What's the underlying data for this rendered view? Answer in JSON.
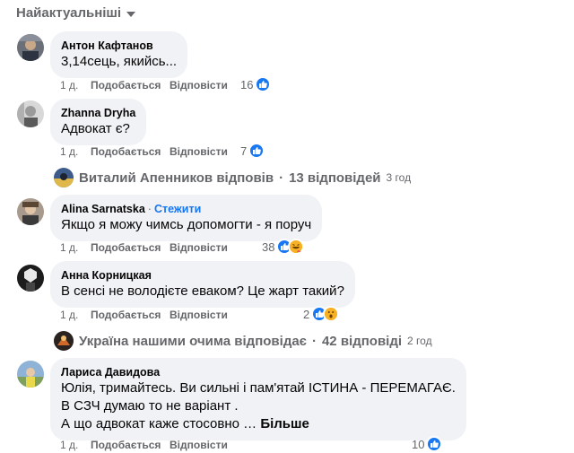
{
  "sort": {
    "label": "Найактуальніші"
  },
  "labels": {
    "like": "Подобається",
    "reply": "Відповісти",
    "dot": "·"
  },
  "comments": [
    {
      "author": "Антон Кафтанов",
      "text": [
        "3,14сець, якийсь..."
      ],
      "time": "1 д.",
      "reactions": "16",
      "reaction_icons": [
        "like-icon"
      ]
    },
    {
      "author": "Zhanna Dryha",
      "text": [
        "Адвокат є?"
      ],
      "time": "1 д.",
      "reactions": "7",
      "reaction_icons": [
        "like-icon"
      ]
    },
    {
      "author": "Alina Sarnatska",
      "follow": "Стежити",
      "text": [
        "Якщо я можу чимсь допомогти - я поруч"
      ],
      "time": "1 д.",
      "reactions": "38",
      "reaction_icons": [
        "like-icon",
        "haha-icon"
      ]
    },
    {
      "author": "Анна Корницкая",
      "text": [
        "В сенсі не володієте еваком? Це жарт такий?"
      ],
      "time": "1 д.",
      "reactions": "2",
      "reaction_icons": [
        "like-icon",
        "wow-icon"
      ]
    },
    {
      "author": "Лариса Давидова",
      "text": [
        "Юлія, тримайтесь. Ви сильні і пам'ятай ІСТИНА - ПЕРЕМАГАЄ.",
        "В СЗЧ думаю то не варіант .",
        "А що адвокат каже стосовно …"
      ],
      "more": "Більше",
      "time": "1 д.",
      "reactions": "10",
      "reaction_icons": [
        "like-icon"
      ]
    }
  ],
  "reply_threads": [
    {
      "who": "Виталий Апенников відповів",
      "sep": "·",
      "count": "13 відповідей",
      "time": "3 год"
    },
    {
      "who": "Україна нашими очима відповідає",
      "sep": "·",
      "count": "42 відповіді",
      "time": "2 год"
    }
  ],
  "colors": {
    "accent": "#1877f2",
    "secondary_text": "#65676b",
    "bubble_bg": "#f0f2f5"
  }
}
